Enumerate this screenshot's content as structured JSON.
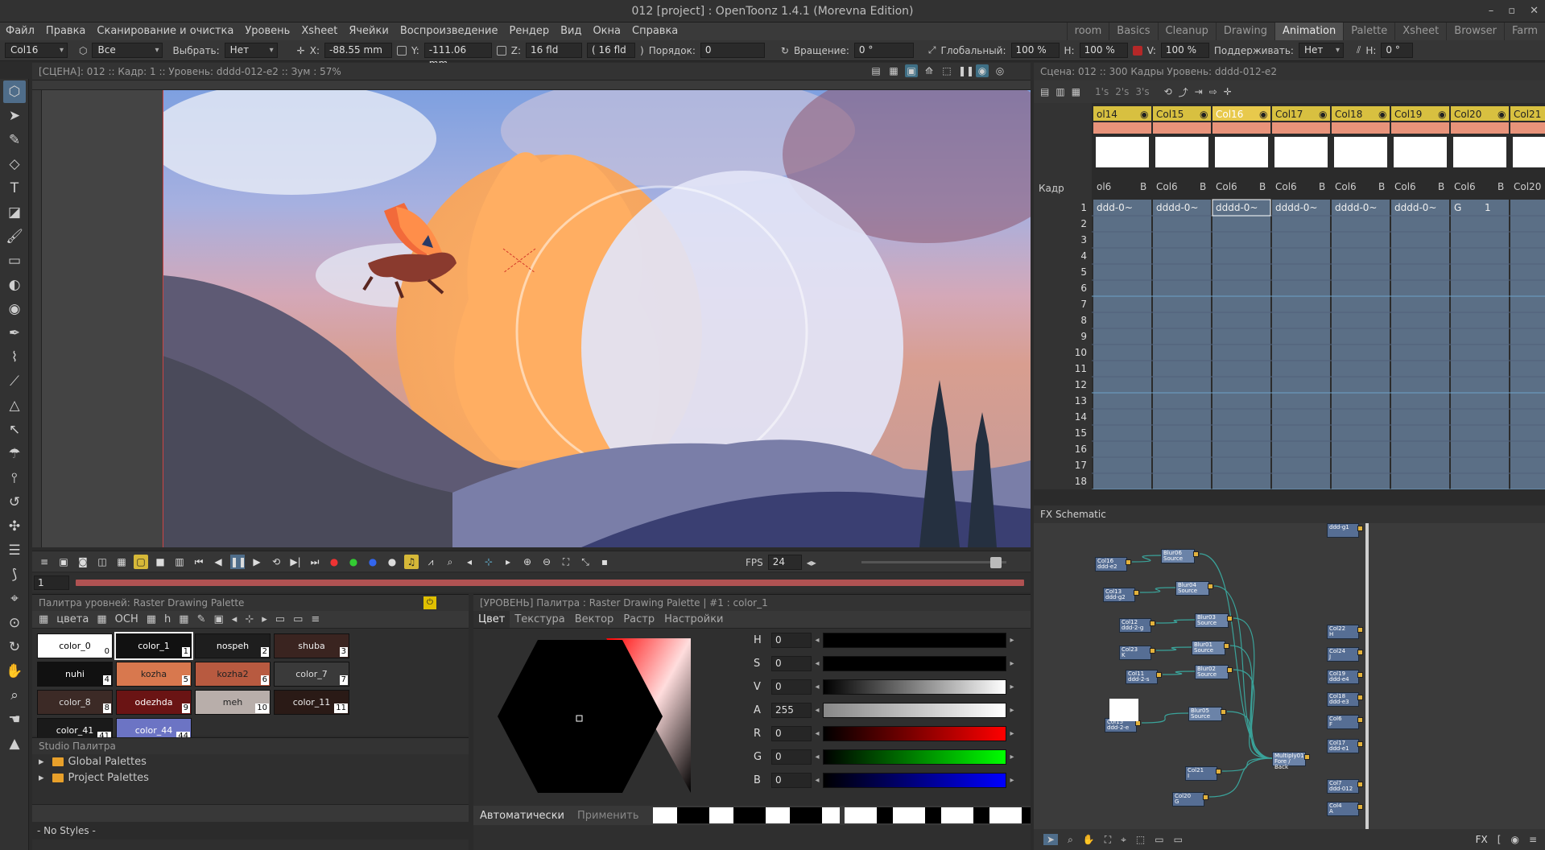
{
  "window": {
    "title": "012 [project] : OpenToonz 1.4.1 (Morevna Edition)"
  },
  "menu": [
    "Файл",
    "Правка",
    "Сканирование и очистка",
    "Уровень",
    "Xsheet",
    "Ячейки",
    "Воспроизведение",
    "Рендер",
    "Вид",
    "Окна",
    "Справка"
  ],
  "rooms": {
    "items": [
      "room",
      "Basics",
      "Cleanup",
      "Drawing",
      "Animation",
      "Palette",
      "Xsheet",
      "Browser",
      "Farm"
    ],
    "active": "Animation"
  },
  "tool_options": {
    "column": "Col16",
    "scope": "Все",
    "select_label": "Выбрать:",
    "select": "Нет",
    "x_label": "X:",
    "x": "-88.55 mm",
    "y_label": "Y:",
    "y": "-111.06 mm",
    "z_label": "Z:",
    "z": "16 fld",
    "z2": "( 16 fld",
    "z2_close": ")",
    "order_label": "Порядок:",
    "order": "0",
    "rotate_label": "Вращение:",
    "rotate": "0 °",
    "global_label": "Глобальный:",
    "global": "100 %",
    "h_label": "H:",
    "h": "100 %",
    "v_label": "V:",
    "v": "100 %",
    "keep_label": "Поддерживать:",
    "keep": "Нет",
    "hsh_label": "H:",
    "hsh": "0 °"
  },
  "viewer": {
    "header": "[СЦЕНА]: 012  ::  Кадр: 1  ::  Уровень: dddd-012-e2  ::  Зум : 57%"
  },
  "playback": {
    "fps_label": "FPS",
    "fps": "24",
    "frame": "1"
  },
  "level_palette": {
    "header": "Палитра уровней: Raster Drawing Palette",
    "tab_label": "цвета",
    "mode_label": "ОСН",
    "h_label": "h",
    "chips": [
      {
        "name": "color_0",
        "idx": "0",
        "bg": "#ffffff",
        "fg": "#000"
      },
      {
        "name": "color_1",
        "idx": "1",
        "bg": "#111111",
        "fg": "#fff",
        "sel": true
      },
      {
        "name": "nospeh",
        "idx": "2",
        "bg": "#1e1e1e",
        "fg": "#fff"
      },
      {
        "name": "shuba",
        "idx": "3",
        "bg": "#3a2420",
        "fg": "#eee"
      },
      {
        "name": "nuhi",
        "idx": "4",
        "bg": "#111111",
        "fg": "#fff"
      },
      {
        "name": "kozha",
        "idx": "5",
        "bg": "#d8784e",
        "fg": "#222"
      },
      {
        "name": "kozha2",
        "idx": "6",
        "bg": "#b85a40",
        "fg": "#222"
      },
      {
        "name": "color_7",
        "idx": "7",
        "bg": "#3a3a3a",
        "fg": "#ddd"
      },
      {
        "name": "color_8",
        "idx": "8",
        "bg": "#3c2a26",
        "fg": "#ddd"
      },
      {
        "name": "odezhda",
        "idx": "9",
        "bg": "#6a1414",
        "fg": "#fff"
      },
      {
        "name": "meh",
        "idx": "10",
        "bg": "#b8aeaa",
        "fg": "#222"
      },
      {
        "name": "color_11",
        "idx": "11",
        "bg": "#2a1a16",
        "fg": "#eee"
      },
      {
        "name": "color_41",
        "idx": "41",
        "bg": "#1a1a1a",
        "fg": "#fff"
      },
      {
        "name": "color_44",
        "idx": "44",
        "bg": "#6c74c4",
        "fg": "#fff"
      }
    ]
  },
  "studio_palette": {
    "header": "Studio Палитра",
    "folders": [
      "Global Palettes",
      "Project Palettes"
    ],
    "status": "- No Styles -"
  },
  "style_editor": {
    "header": "[УРОВЕНЬ]  Палитра : Raster Drawing Palette | #1 : color_1",
    "tabs": [
      "Цвет",
      "Текстура",
      "Вектор",
      "Растр",
      "Настройки"
    ],
    "channels": [
      {
        "label": "H",
        "value": "0"
      },
      {
        "label": "S",
        "value": "0"
      },
      {
        "label": "V",
        "value": "0"
      },
      {
        "label": "A",
        "value": "255"
      },
      {
        "label": "R",
        "value": "0"
      },
      {
        "label": "G",
        "value": "0"
      },
      {
        "label": "B",
        "value": "0"
      }
    ],
    "auto_label": "Автоматически",
    "apply_label": "Применить"
  },
  "xsheet": {
    "header": "Сцена: 012  ::  300 Кадры  Уровень: dddd-012-e2",
    "step_buttons": [
      "1's",
      "2's",
      "3's"
    ],
    "frame_label": "Кадр",
    "columns": [
      {
        "name": "ol14",
        "sub": "ol6",
        "b": "B",
        "cell": "ddd-0~"
      },
      {
        "name": "Col15",
        "sub": "Col6",
        "b": "B",
        "cell": "dddd-0~"
      },
      {
        "name": "Col16",
        "sub": "Col6",
        "b": "B",
        "cell": "dddd-0~",
        "active": true
      },
      {
        "name": "Col17",
        "sub": "Col6",
        "b": "B",
        "cell": "dddd-0~"
      },
      {
        "name": "Col18",
        "sub": "Col6",
        "b": "B",
        "cell": "dddd-0~"
      },
      {
        "name": "Col19",
        "sub": "Col6",
        "b": "B",
        "cell": "dddd-0~"
      },
      {
        "name": "Col20",
        "sub": "Col6",
        "b": "B",
        "cell": "G"
      },
      {
        "name": "Col21",
        "sub": "Col20",
        "b": "",
        "cell": ""
      }
    ],
    "col20_cell_num": "1",
    "rows": [
      "1",
      "2",
      "3",
      "4",
      "5",
      "6",
      "7",
      "8",
      "9",
      "10",
      "11",
      "12",
      "13",
      "14",
      "15",
      "16",
      "17",
      "18"
    ]
  },
  "fx": {
    "header": "FX Schematic",
    "nodes_left": [
      {
        "t": "Col16",
        "s": "ddd-e2"
      },
      {
        "t": "Col13",
        "s": "ddd-g2"
      },
      {
        "t": "Col12",
        "s": "ddd-2-g"
      },
      {
        "t": "Col23",
        "s": "K"
      },
      {
        "t": "Col11",
        "s": "ddd-2-s"
      },
      {
        "t": "Col15",
        "s": "ddd-2-e"
      },
      {
        "t": "Col21",
        "s": "I"
      },
      {
        "t": "Col20",
        "s": "G"
      }
    ],
    "nodes_blur": [
      {
        "t": "Blur06",
        "s": "Source"
      },
      {
        "t": "Blur04",
        "s": "Source"
      },
      {
        "t": "Blur03",
        "s": "Source"
      },
      {
        "t": "Blur01",
        "s": "Source"
      },
      {
        "t": "Blur02",
        "s": "Source"
      },
      {
        "t": "Blur05",
        "s": "Source"
      }
    ],
    "multiply": {
      "t": "Multiply01",
      "a": "Fore",
      "b": "Back"
    },
    "nodes_right": [
      {
        "t": "Col22",
        "s": "H"
      },
      {
        "t": "Col24",
        "s": "J"
      },
      {
        "t": "Col19",
        "s": "ddd-e4"
      },
      {
        "t": "Col18",
        "s": "ddd-e3"
      },
      {
        "t": "Col6",
        "s": "F"
      },
      {
        "t": "Col17",
        "s": "ddd-e1"
      },
      {
        "t": "Col7",
        "s": "ddd-012"
      },
      {
        "t": "Col4",
        "s": "A"
      }
    ],
    "top_node": "ddd-g1",
    "fx_label": "FX"
  }
}
